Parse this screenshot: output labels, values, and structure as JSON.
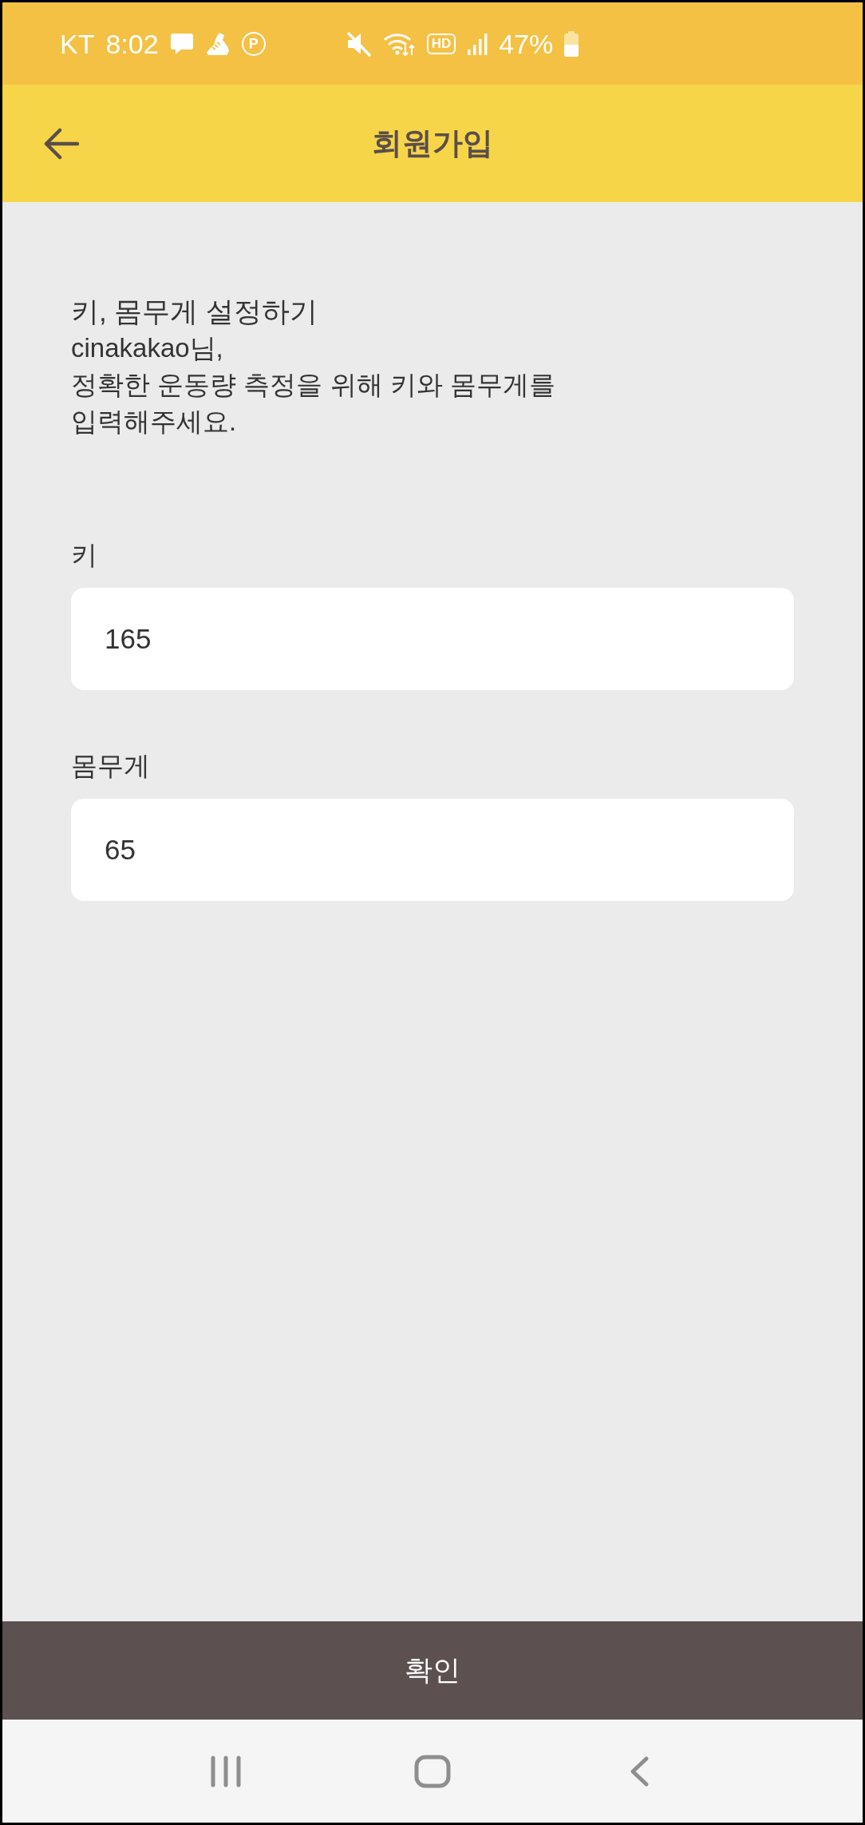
{
  "status_bar": {
    "carrier": "KT",
    "time": "8:02",
    "app_badge": "P",
    "hd_badge": "HD",
    "battery": "47%"
  },
  "app_bar": {
    "title": "회원가입"
  },
  "form": {
    "heading": "키, 몸무게 설정하기",
    "message": "cinakakao님,\n정확한 운동량 측정을 위해 키와 몸무게를\n입력해주세요.",
    "fields": [
      {
        "label": "키",
        "value": "165"
      },
      {
        "label": "몸무게",
        "value": "65"
      }
    ]
  },
  "confirm_button": {
    "label": "확인"
  }
}
